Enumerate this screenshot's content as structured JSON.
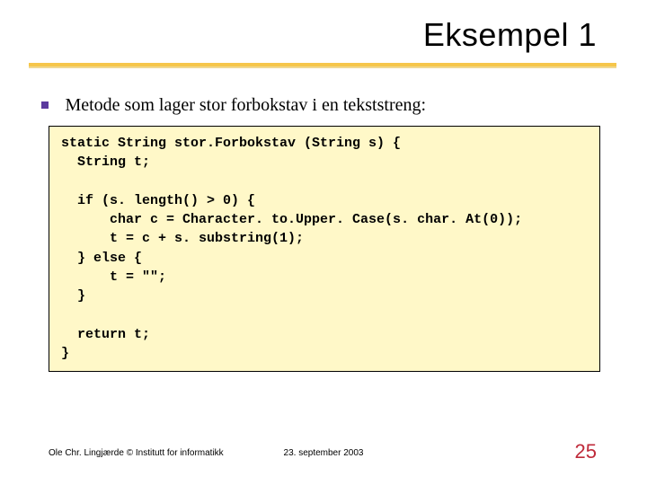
{
  "title": "Eksempel 1",
  "bullet": "Metode som lager stor forbokstav i en tekststreng:",
  "code": " static String stor.Forbokstav (String s) {\n   String t;\n\n   if (s. length() > 0) {\n       char c = Character. to.Upper. Case(s. char. At(0));\n       t = c + s. substring(1);\n   } else {\n       t = \"\";\n   }\n\n   return t;\n }",
  "footer": {
    "left": "Ole Chr. Lingjærde © Institutt for informatikk",
    "center": "23. september 2003",
    "right": "25"
  }
}
